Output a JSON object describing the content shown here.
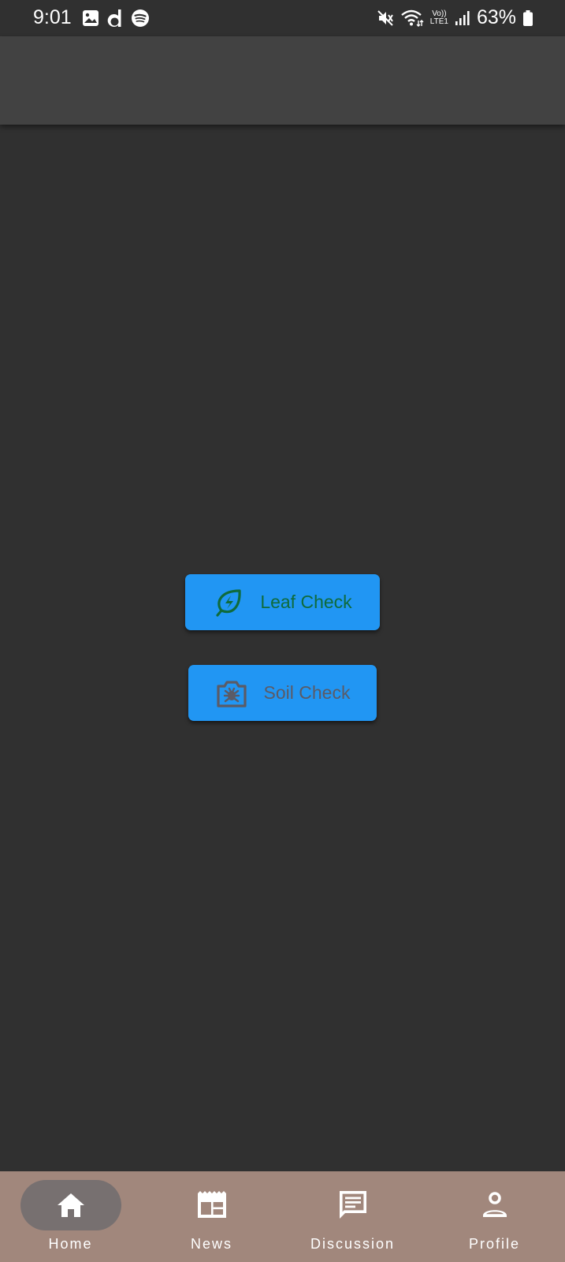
{
  "status_bar": {
    "time": "9:01",
    "lte_label_top": "Vo))",
    "lte_label_bottom": "LTE1",
    "battery": "63%",
    "left_icons": [
      "gallery-icon",
      "d-app-icon",
      "spotify-icon"
    ],
    "right_icons": [
      "mute-icon",
      "wifi-icon",
      "lte-icon",
      "signal-icon",
      "battery-icon"
    ]
  },
  "main": {
    "leaf_check": {
      "label": "Leaf Check",
      "icon": "leaf-bolt-icon",
      "label_color": "#0f6b3c"
    },
    "soil_check": {
      "label": "Soil Check",
      "icon": "camera-bug-icon",
      "label_color": "#5b5b66"
    },
    "button_color": "#2196f3"
  },
  "bottom_nav": {
    "items": [
      {
        "label": "Home",
        "icon": "home-icon",
        "active": true
      },
      {
        "label": "News",
        "icon": "news-icon",
        "active": false
      },
      {
        "label": "Discussion",
        "icon": "chat-icon",
        "active": false
      },
      {
        "label": "Profile",
        "icon": "profile-icon",
        "active": false
      }
    ],
    "background": "#a1877c"
  },
  "colors": {
    "background": "#303030",
    "app_bar": "#424242"
  }
}
